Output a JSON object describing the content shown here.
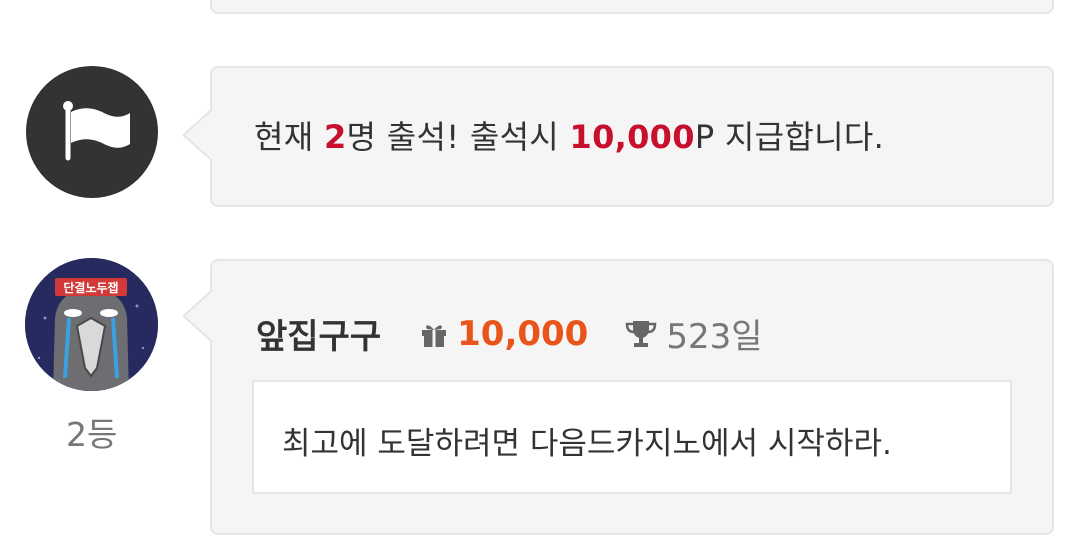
{
  "notice": {
    "prefix": "현재 ",
    "count": "2",
    "middle": "명 출석! 출석시 ",
    "reward": "10,000",
    "suffix": "P 지급합니다."
  },
  "comment": {
    "avatar_text": "단결노두잽",
    "rank": "2등",
    "nickname": "앞집구구",
    "points": "10,000",
    "days": "523일",
    "text": "최고에 도달하려면 다음드카지노에서 시작하라."
  },
  "colors": {
    "accent_red": "#c8102e",
    "accent_orange": "#e8541a",
    "card_bg": "#f5f5f5",
    "border": "#e6e6e6"
  },
  "icons": [
    "flag-icon",
    "gift-icon",
    "trophy-icon"
  ]
}
